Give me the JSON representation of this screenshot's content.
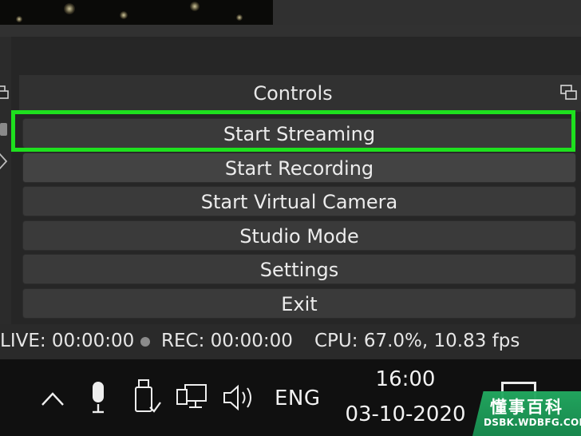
{
  "dock": {
    "title": "Controls"
  },
  "controls": {
    "buttons": [
      {
        "label": "Start Streaming"
      },
      {
        "label": "Start Recording",
        "highlighted": true
      },
      {
        "label": "Start Virtual Camera"
      },
      {
        "label": "Studio Mode"
      },
      {
        "label": "Settings"
      },
      {
        "label": "Exit"
      }
    ]
  },
  "status": {
    "live": "LIVE: 00:00:00",
    "rec": "REC: 00:00:00",
    "cpu": "CPU: 67.0%, 10.83 fps"
  },
  "taskbar": {
    "language": "ENG",
    "time": "16:00",
    "date": "03-10-2020",
    "icons": [
      "chevron-up-icon",
      "microphone-icon",
      "usb-icon",
      "network-icon",
      "speaker-icon",
      "notification-icon"
    ]
  },
  "watermark": {
    "cn": "懂事百科",
    "en": "DSBK.WDBFG.COM"
  },
  "colors": {
    "highlight": "#1ee01e",
    "button": "#3a3a3a",
    "panel": "#262626",
    "taskbar": "#101010",
    "watermark": "#22aa60"
  }
}
